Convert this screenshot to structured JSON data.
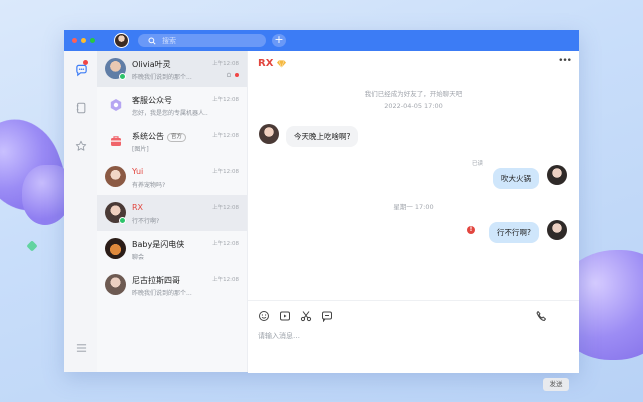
{
  "app": {
    "search_placeholder": "搜索",
    "plus": "+"
  },
  "conversations": [
    {
      "name": "Olivia叶灵",
      "preview": "昨晚我们说到的那个...",
      "time": "上午12:08"
    },
    {
      "name": "客服公众号",
      "preview": "您好，我是您的专属机器人..",
      "time": "上午12:08"
    },
    {
      "name": "系统公告",
      "tag": "官方",
      "preview": "[图片]",
      "time": "上午12:08"
    },
    {
      "name": "Yui",
      "preview": "有养宠物吗?",
      "time": "上午12:08"
    },
    {
      "name": "RX",
      "preview": "行不行啊?",
      "time": "上午12:08"
    },
    {
      "name": "Baby是闪电侠",
      "preview": "聊会",
      "time": "上午12:08"
    },
    {
      "name": "尼古拉斯四哥",
      "preview": "昨晚我们说到的那个...",
      "time": "上午12:08"
    }
  ],
  "chat": {
    "title": "RX",
    "more": "•••",
    "system_1": "我们已经成为好友了，开始聊天吧",
    "system_1_time": "2022-04-05 17:00",
    "msg_in_1": "今天晚上吃啥啊?",
    "read_label": "已读",
    "msg_out_1": "吹大火锅",
    "system_2_time": "星期一 17:00",
    "msg_out_2": "行不行啊?",
    "error_mark": "!",
    "input_placeholder": "请输入消息…",
    "send_label": "发送"
  },
  "colors": {
    "titlebar": "#3c7cf5",
    "accent_red": "#e2463f",
    "bubble_out": "#cfe6fb",
    "online": "#2dc36a"
  }
}
